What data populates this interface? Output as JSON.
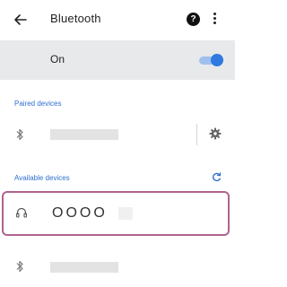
{
  "app_bar": {
    "title": "Bluetooth",
    "help_glyph": "?",
    "back_icon": "arrow-back-icon",
    "more_icon": "more-vert-icon"
  },
  "toggle_row": {
    "label": "On",
    "enabled": true
  },
  "paired": {
    "header": "Paired devices"
  },
  "available": {
    "header": "Available devices",
    "selected_device_name": "OOOO"
  },
  "colors": {
    "accent": "#2f79df",
    "section_header": "#2f6fd0",
    "highlight_border": "#b0628f",
    "toggle_row_bg": "#e7e9eb"
  }
}
